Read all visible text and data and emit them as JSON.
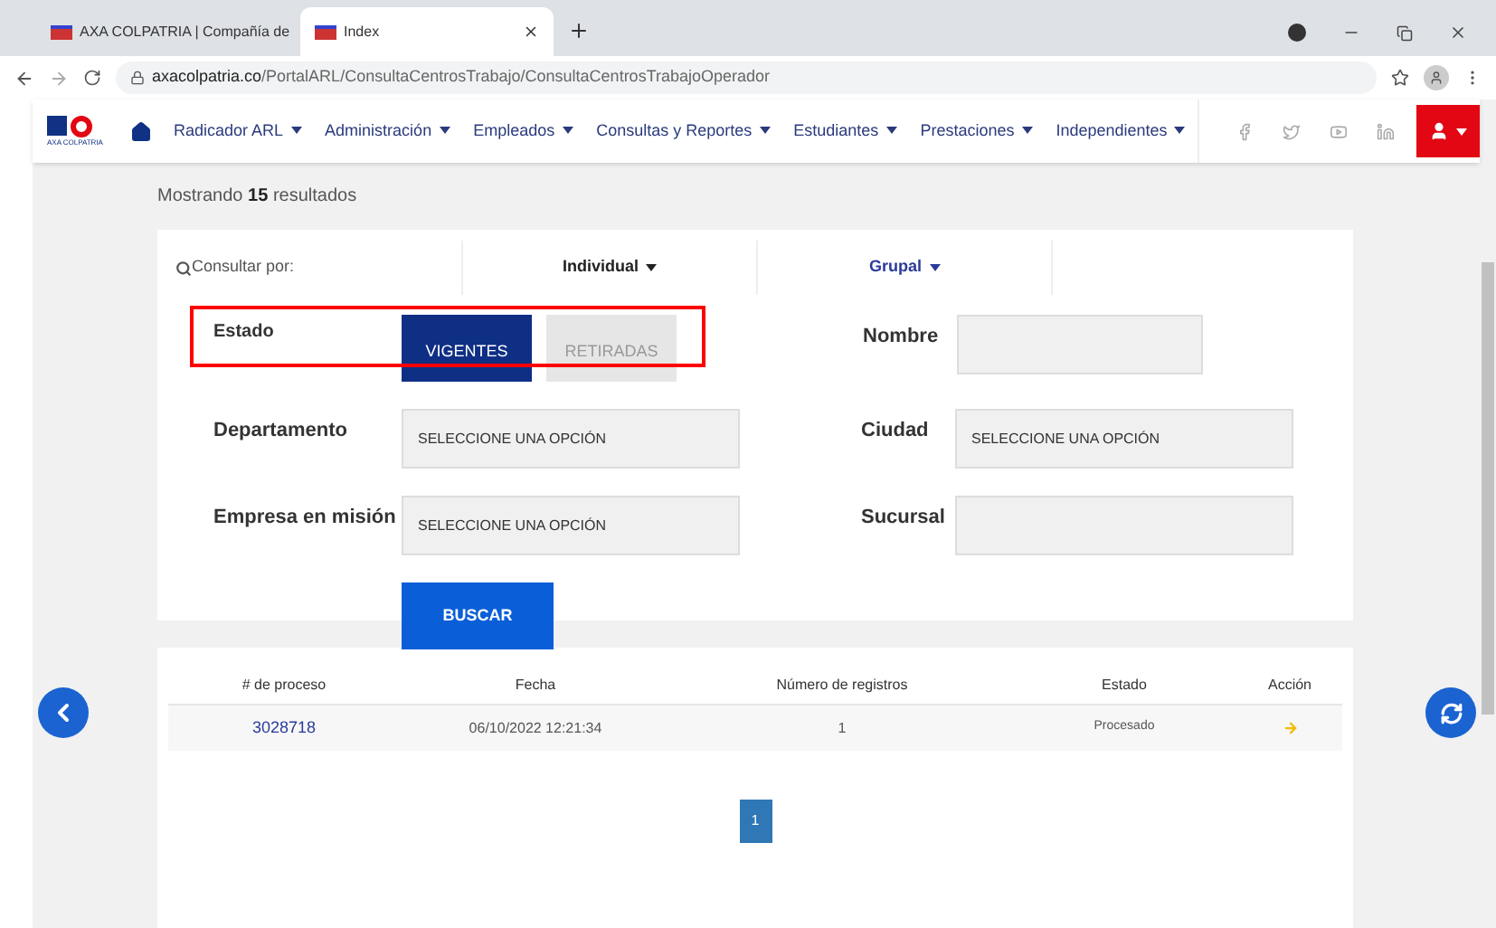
{
  "browser": {
    "tabs": [
      {
        "title": "AXA COLPATRIA | Compañía de",
        "selected": false
      },
      {
        "title": "Index",
        "selected": true
      }
    ],
    "url_host": "axacolpatria.co",
    "url_path": "/PortalARL/ConsultaCentrosTrabajo/ConsultaCentrosTrabajoOperador"
  },
  "navbar": {
    "logo_text": "AXA COLPATRIA",
    "menu": [
      "Radicador ARL",
      "Administración",
      "Empleados",
      "Consultas y Reportes",
      "Estudiantes",
      "Prestaciones",
      "Independientes"
    ]
  },
  "results": {
    "prefix": "Mostrando",
    "count": "15",
    "suffix": "resultados"
  },
  "search": {
    "label": "Consultar por:",
    "modes": [
      {
        "label": "Individual",
        "selected": true
      },
      {
        "label": "Grupal",
        "selected": false
      }
    ],
    "estado": {
      "label": "Estado",
      "options": [
        {
          "label": "VIGENTES",
          "selected": true
        },
        {
          "label": "RETIRADAS",
          "selected": false
        }
      ]
    },
    "nombre": {
      "label": "Nombre"
    },
    "departamento": {
      "label": "Departamento",
      "value": "SELECCIONE UNA OPCIÓN"
    },
    "ciudad": {
      "label": "Ciudad",
      "value": "SELECCIONE UNA OPCIÓN"
    },
    "empresa": {
      "label": "Empresa en misión",
      "value": "SELECCIONE UNA OPCIÓN"
    },
    "sucursal": {
      "label": "Sucursal"
    },
    "button": "BUSCAR"
  },
  "table": {
    "columns": [
      "# de proceso",
      "Fecha",
      "Número de registros",
      "Estado",
      "Acción"
    ],
    "rows": [
      {
        "proceso": "3028718",
        "fecha": "06/10/2022 12:21:34",
        "registros": "1",
        "estado": "Procesado"
      }
    ]
  },
  "pagination": [
    {
      "label": "1",
      "selected": true
    }
  ]
}
